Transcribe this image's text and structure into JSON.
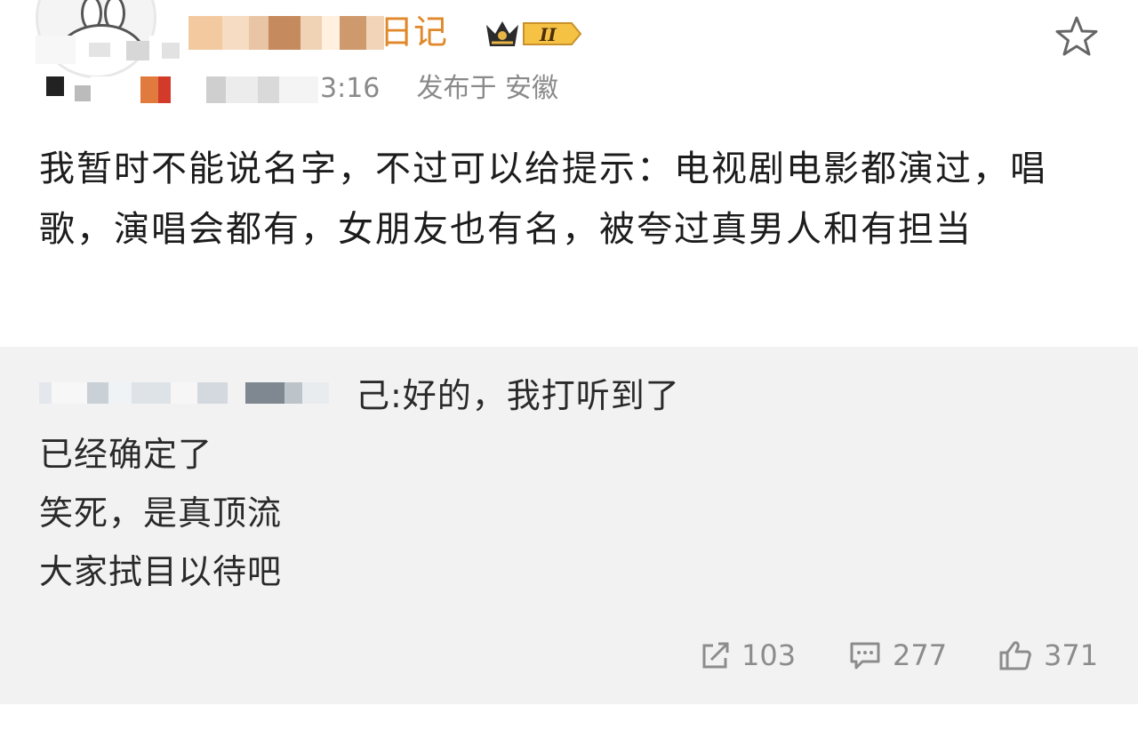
{
  "post": {
    "username_visible": "日记",
    "level_badge": "II",
    "time_fragment": "3:16",
    "posted_from": "发布于 安徽",
    "body": "我暂时不能说名字，不过可以给提示：电视剧电影都演过，唱歌，演唱会都有，女朋友也有名，被夸过真男人和有担当"
  },
  "repost": {
    "lines": [
      "已经确定了",
      "笑死，是真顶流",
      "大家拭目以待吧"
    ],
    "first_line_suffix": "己:好的，我打听到了",
    "mention_prefix": "@"
  },
  "actions": {
    "share_count": "103",
    "comment_count": "277",
    "like_count": "371"
  },
  "colors": {
    "username": "#e0882a",
    "meta": "#8a8a8a",
    "repost_bg": "#f2f2f2"
  },
  "icons": [
    "avatar",
    "crown-icon",
    "star-icon",
    "share-icon",
    "comment-icon",
    "like-icon"
  ]
}
